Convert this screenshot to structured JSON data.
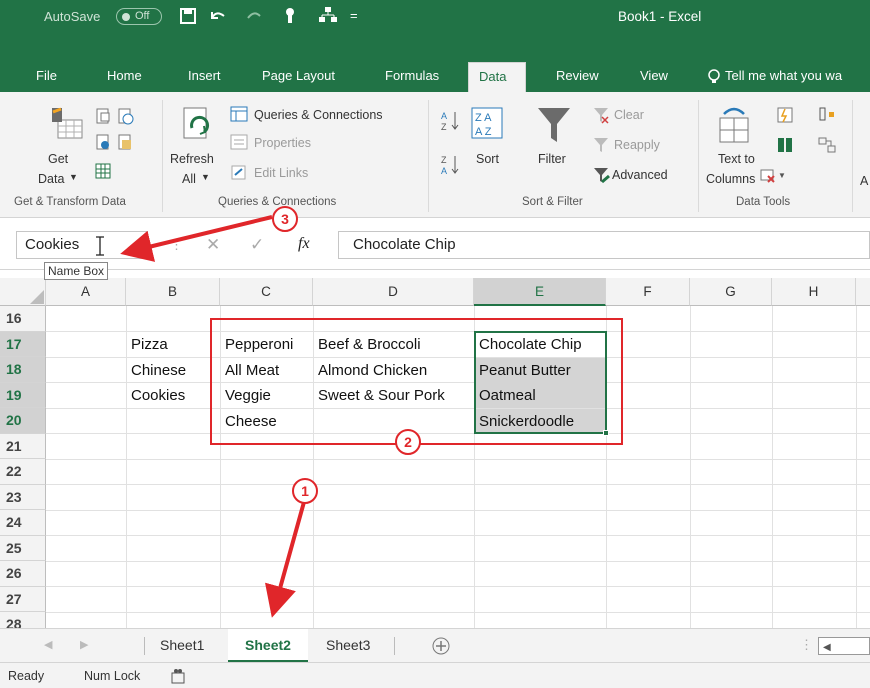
{
  "title_bar": {
    "autosave_label": "AutoSave",
    "autosave_state": "Off",
    "document_title": "Book1 - Excel"
  },
  "tabs": [
    "File",
    "Home",
    "Insert",
    "Page Layout",
    "Formulas",
    "Data",
    "Review",
    "View"
  ],
  "tell_me": "Tell me what you wa",
  "ribbon": {
    "get_data": "Get",
    "get_data_2": "Data",
    "refresh": "Refresh",
    "refresh_all": "All",
    "queries_connections": "Queries & Connections",
    "properties": "Properties",
    "edit_links": "Edit Links",
    "sort": "Sort",
    "filter": "Filter",
    "clear": "Clear",
    "reapply": "Reapply",
    "advanced": "Advanced",
    "text_to": "Text to",
    "columns": "Columns",
    "cut_letter": "A",
    "groups": {
      "get_transform": "Get & Transform Data",
      "queries": "Queries & Connections",
      "sort_filter": "Sort & Filter",
      "data_tools": "Data Tools"
    }
  },
  "name_box": {
    "value": "Cookies",
    "tooltip": "Name Box"
  },
  "formula_bar": {
    "fx": "fx",
    "value": "Chocolate Chip"
  },
  "columns": [
    "A",
    "B",
    "C",
    "D",
    "E",
    "F",
    "G",
    "H"
  ],
  "rows": [
    "16",
    "17",
    "18",
    "19",
    "20",
    "21",
    "22",
    "23",
    "24",
    "25",
    "26",
    "27",
    "28"
  ],
  "cells": {
    "B17": "Pizza",
    "B18": "Chinese",
    "B19": "Cookies",
    "C17": "Pepperoni",
    "C18": "All Meat",
    "C19": "Veggie",
    "C20": "Cheese",
    "D17": "Beef & Broccoli",
    "D18": "Almond Chicken",
    "D19": "Sweet & Sour Pork",
    "E17": "Chocolate Chip",
    "E18": "Peanut Butter",
    "E19": "Oatmeal",
    "E20": "Snickerdoodle"
  },
  "sheets": [
    "Sheet1",
    "Sheet2",
    "Sheet3"
  ],
  "status": {
    "ready": "Ready",
    "num_lock": "Num Lock"
  },
  "callouts": [
    "1",
    "2",
    "3"
  ],
  "colors": {
    "excel_green": "#217346",
    "callout_red": "#e0262a"
  }
}
